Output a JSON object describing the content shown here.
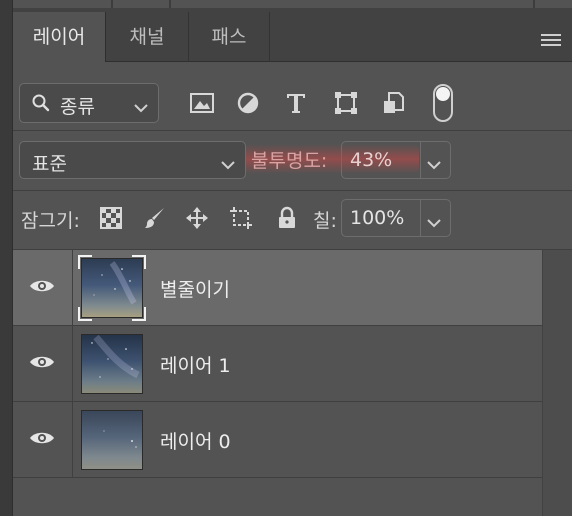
{
  "tabs": [
    {
      "label": "레이어",
      "active": true
    },
    {
      "label": "채널",
      "active": false
    },
    {
      "label": "패스",
      "active": false
    }
  ],
  "filter": {
    "kind_label": "종류",
    "icons": [
      "image-filter-icon",
      "adjustment-filter-icon",
      "type-filter-icon",
      "shape-filter-icon",
      "smart-object-filter-icon",
      "filter-toggle"
    ]
  },
  "blend": {
    "mode": "표준",
    "opacity_label": "불투명도:",
    "opacity_value": "43%"
  },
  "lock": {
    "label": "잠그기:",
    "icons": [
      "lock-transparent-pixels-icon",
      "lock-image-pixels-icon",
      "lock-position-icon",
      "lock-artboard-icon",
      "lock-all-icon"
    ],
    "fill_label": "칠:",
    "fill_value": "100%"
  },
  "layers": [
    {
      "name": "별줄이기",
      "visible": true,
      "selected": true
    },
    {
      "name": "레이어 1",
      "visible": true,
      "selected": false
    },
    {
      "name": "레이어 0",
      "visible": true,
      "selected": false
    }
  ],
  "colors": {
    "panel_bg": "#535353",
    "selected_row": "#6a6a6a",
    "opacity_highlight": "#c84646"
  }
}
